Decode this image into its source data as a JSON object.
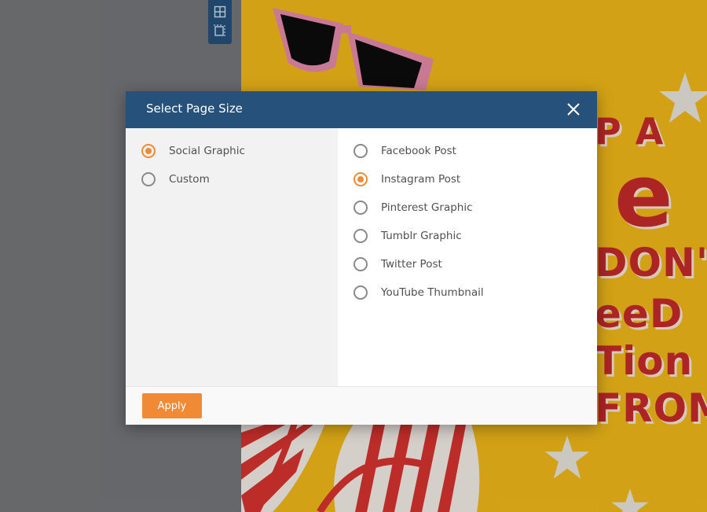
{
  "dialog": {
    "title": "Select Page Size",
    "apply_label": "Apply",
    "categories": [
      {
        "label": "Social Graphic",
        "checked": true
      },
      {
        "label": "Custom",
        "checked": false
      }
    ],
    "sizes": [
      {
        "label": "Facebook Post",
        "checked": false
      },
      {
        "label": "Instagram Post",
        "checked": true
      },
      {
        "label": "Pinterest Graphic",
        "checked": false
      },
      {
        "label": "Tumblr Graphic",
        "checked": false
      },
      {
        "label": "Twitter Post",
        "checked": false
      },
      {
        "label": "YouTube Thumbnail",
        "checked": false
      }
    ]
  },
  "toolbar": {
    "icons": [
      "grid-icon",
      "page-size-icon"
    ]
  },
  "poster": {
    "lines": [
      "P A",
      "e",
      "DON'",
      "eeD",
      "Tion",
      "FROM"
    ]
  },
  "colors": {
    "header": "#25517a",
    "accent": "#f08a35",
    "poster_bg": "#f0b81a",
    "poster_text": "#c42a2a"
  }
}
